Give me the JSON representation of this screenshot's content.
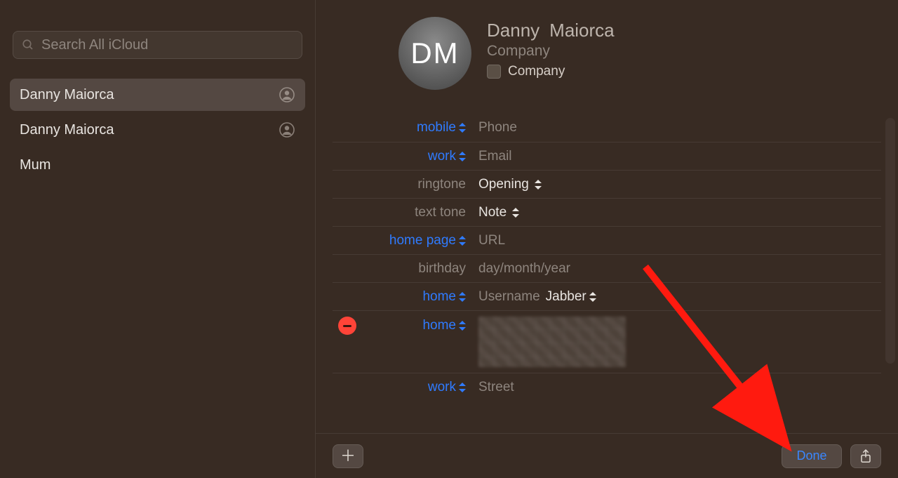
{
  "search": {
    "placeholder": "Search All iCloud"
  },
  "contacts": [
    {
      "name": "Danny  Maiorca",
      "selected": true,
      "has_silhouette": true
    },
    {
      "name": "Danny Maiorca",
      "selected": false,
      "has_silhouette": true
    },
    {
      "name": "Mum",
      "selected": false,
      "has_silhouette": false
    }
  ],
  "card": {
    "initials": "DM",
    "first_name": "Danny",
    "last_name": "Maiorca",
    "company_placeholder": "Company",
    "company_checkbox_label": "Company"
  },
  "fields": {
    "mobile": {
      "label": "mobile",
      "value_placeholder": "Phone"
    },
    "work_email": {
      "label": "work",
      "value_placeholder": "Email"
    },
    "ringtone": {
      "label": "ringtone",
      "value": "Opening"
    },
    "texttone": {
      "label": "text tone",
      "value": "Note"
    },
    "homepage": {
      "label": "home page",
      "value_placeholder": "URL"
    },
    "birthday": {
      "label": "birthday",
      "value_placeholder": "day/month/year"
    },
    "im": {
      "label": "home",
      "value_placeholder": "Username",
      "service": "Jabber"
    },
    "address_home": {
      "label": "home"
    },
    "address_work": {
      "label": "work",
      "value_placeholder": "Street"
    }
  },
  "toolbar": {
    "done_label": "Done"
  }
}
